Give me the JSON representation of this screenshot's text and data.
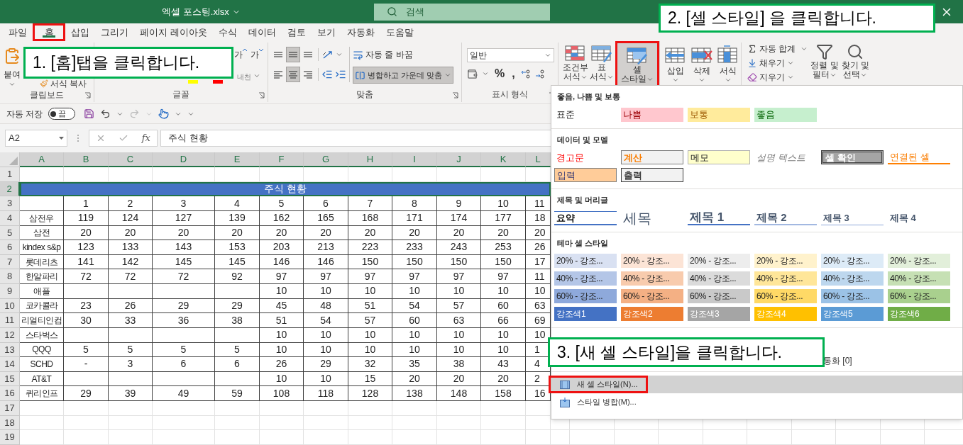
{
  "title_bar": {
    "file_name": "엑셀 포스팅.xlsx",
    "search_placeholder": "검색"
  },
  "ribbon_tabs": [
    {
      "label": "파일",
      "selected": false,
      "annotated": false
    },
    {
      "label": "홈",
      "selected": true,
      "annotated": true
    },
    {
      "label": "삽입",
      "selected": false,
      "annotated": false
    },
    {
      "label": "그리기",
      "selected": false,
      "annotated": false
    },
    {
      "label": "페이지 레이아웃",
      "selected": false,
      "annotated": false
    },
    {
      "label": "수식",
      "selected": false,
      "annotated": false
    },
    {
      "label": "데이터",
      "selected": false,
      "annotated": false
    },
    {
      "label": "검토",
      "selected": false,
      "annotated": false
    },
    {
      "label": "보기",
      "selected": false,
      "annotated": false
    },
    {
      "label": "자동화",
      "selected": false,
      "annotated": false
    },
    {
      "label": "도움말",
      "selected": false,
      "annotated": false
    }
  ],
  "ribbon": {
    "clipboard": {
      "paste_label": "붙여",
      "format_painter": "서식 복사",
      "group_label": "클립보드"
    },
    "font": {
      "grow": "가",
      "shrink": "가",
      "phonetic": "내천",
      "group_label": "글꼴"
    },
    "alignment": {
      "buttons": [
        {
          "kind": "top",
          "selected": false
        },
        {
          "kind": "middle",
          "selected": true
        },
        {
          "kind": "bottom",
          "selected": false
        },
        {
          "kind": "left",
          "selected": false
        },
        {
          "kind": "center",
          "selected": true
        },
        {
          "kind": "right",
          "selected": false
        }
      ],
      "wrap": "자동 줄 바꿈",
      "merge": {
        "label": "병합하고 가운데 맞춤",
        "selected": true
      },
      "group_label": "맞춤"
    },
    "number": {
      "format": "일반",
      "symbols": [
        "%",
        ","
      ],
      "group_label": "표시 형식"
    },
    "styles": [
      {
        "kind": "conditional",
        "lines": [
          "조건부",
          "서식"
        ],
        "selected": false,
        "annotated": false
      },
      {
        "kind": "table",
        "lines": [
          "표",
          "서식"
        ],
        "selected": false,
        "annotated": false
      },
      {
        "kind": "cell_style",
        "lines": [
          "셀",
          "스타일"
        ],
        "selected": true,
        "annotated": true
      }
    ],
    "cells": [
      {
        "kind": "insert",
        "label": "삽입"
      },
      {
        "kind": "delete",
        "label": "삭제"
      },
      {
        "kind": "format",
        "label": "서식"
      }
    ],
    "editing": {
      "autosum": "자동 합계",
      "fill": "채우기",
      "clear": "지우기",
      "sort": [
        "정렬 및",
        "필터"
      ],
      "find": [
        "찾기 및",
        "선택"
      ]
    }
  },
  "quick_access": {
    "autosave_label": "자동 저장",
    "autosave_on": false,
    "autosave_state": "끔"
  },
  "formula_bar": {
    "name_box": "A2",
    "function_label": "fx",
    "content": "주식 현황"
  },
  "sheet": {
    "columns": [
      {
        "label": "A",
        "selected": true
      },
      {
        "label": "B",
        "selected": true
      },
      {
        "label": "C",
        "selected": true
      },
      {
        "label": "D",
        "selected": true
      },
      {
        "label": "E",
        "selected": true
      },
      {
        "label": "F",
        "selected": true
      },
      {
        "label": "G",
        "selected": true
      },
      {
        "label": "H",
        "selected": true
      },
      {
        "label": "I",
        "selected": true
      },
      {
        "label": "J",
        "selected": true
      },
      {
        "label": "K",
        "selected": true
      },
      {
        "label": "L",
        "selected": true
      }
    ],
    "rows": [
      {
        "number": "1",
        "selected": false,
        "kind": "blank"
      },
      {
        "number": "2",
        "selected": true,
        "kind": "merged",
        "text": "주식 현황"
      },
      {
        "number": "3",
        "selected": false,
        "kind": "table",
        "cells": [
          null,
          "1",
          "2",
          "3",
          "4",
          "5",
          "6",
          "7",
          "8",
          "9",
          "10",
          "11"
        ]
      },
      {
        "number": "4",
        "selected": false,
        "kind": "table",
        "cells": [
          "삼전우",
          "119",
          "124",
          "127",
          "139",
          "162",
          "165",
          "168",
          "171",
          "174",
          "177",
          "18"
        ]
      },
      {
        "number": "5",
        "selected": false,
        "kind": "table",
        "cells": [
          "삼전",
          "20",
          "20",
          "20",
          "20",
          "20",
          "20",
          "20",
          "20",
          "20",
          "20",
          "20"
        ]
      },
      {
        "number": "6",
        "selected": false,
        "kind": "table",
        "cells": [
          "kindex s&p",
          "123",
          "133",
          "143",
          "153",
          "203",
          "213",
          "223",
          "233",
          "243",
          "253",
          "26"
        ]
      },
      {
        "number": "7",
        "selected": false,
        "kind": "table",
        "cells": [
          "롯데리츠",
          "141",
          "142",
          "145",
          "145",
          "146",
          "146",
          "150",
          "150",
          "150",
          "150",
          "17"
        ]
      },
      {
        "number": "8",
        "selected": false,
        "kind": "table",
        "cells": [
          "한알파리",
          "72",
          "72",
          "72",
          "92",
          "97",
          "97",
          "97",
          "97",
          "97",
          "97",
          "11"
        ]
      },
      {
        "number": "9",
        "selected": false,
        "kind": "table",
        "cells": [
          "애플",
          null,
          null,
          null,
          null,
          "10",
          "10",
          "10",
          "10",
          "10",
          "10",
          "10"
        ]
      },
      {
        "number": "10",
        "selected": false,
        "kind": "table",
        "cells": [
          "코카콜라",
          "23",
          "26",
          "29",
          "29",
          "45",
          "48",
          "51",
          "54",
          "57",
          "60",
          "63"
        ]
      },
      {
        "number": "11",
        "selected": false,
        "kind": "table",
        "cells": [
          "리얼티인컴",
          "30",
          "33",
          "36",
          "38",
          "51",
          "54",
          "57",
          "60",
          "63",
          "66",
          "69"
        ]
      },
      {
        "number": "12",
        "selected": false,
        "kind": "table",
        "cells": [
          "스타벅스",
          null,
          null,
          null,
          null,
          "10",
          "10",
          "10",
          "10",
          "10",
          "10",
          "10"
        ]
      },
      {
        "number": "13",
        "selected": false,
        "kind": "table",
        "cells": [
          "QQQ",
          "5",
          "5",
          "5",
          "5",
          "10",
          "10",
          "10",
          "10",
          "10",
          "10",
          "1"
        ]
      },
      {
        "number": "14",
        "selected": false,
        "kind": "table",
        "cells": [
          "SCHD",
          "-",
          "3",
          "6",
          "6",
          "26",
          "29",
          "32",
          "35",
          "38",
          "43",
          "4"
        ]
      },
      {
        "number": "15",
        "selected": false,
        "kind": "table",
        "cells": [
          "AT&T",
          null,
          null,
          null,
          null,
          "10",
          "10",
          "15",
          "20",
          "20",
          "20",
          "2"
        ]
      },
      {
        "number": "16",
        "selected": false,
        "kind": "table",
        "cells": [
          "퀴리인프",
          "29",
          "39",
          "49",
          "59",
          "108",
          "118",
          "128",
          "138",
          "148",
          "158",
          "16"
        ]
      },
      {
        "number": "17",
        "selected": false,
        "kind": "blank"
      },
      {
        "number": "18",
        "selected": false,
        "kind": "blank"
      },
      {
        "number": "19",
        "selected": false,
        "kind": "blank"
      }
    ]
  },
  "cell_styles_menu": {
    "sections": [
      {
        "title": "좋음, 나쁨 및 보통",
        "rows": [
          [
            {
              "kind": "normal",
              "label": "표준"
            },
            {
              "kind": "bad",
              "label": "나쁨"
            },
            {
              "kind": "neutral",
              "label": "보통"
            },
            {
              "kind": "good",
              "label": "좋음"
            }
          ]
        ]
      },
      {
        "title": "데이터 및 모델",
        "rows": [
          [
            {
              "kind": "warning",
              "label": "경고문"
            },
            {
              "kind": "calculation",
              "label": "계산"
            },
            {
              "kind": "note",
              "label": "메모"
            },
            {
              "kind": "explanatory",
              "label": "설명 텍스트"
            },
            {
              "kind": "check",
              "label": "셀 확인"
            },
            {
              "kind": "linked",
              "label": "연결된 셀"
            }
          ],
          [
            {
              "kind": "input",
              "label": "입력"
            },
            {
              "kind": "output",
              "label": "출력"
            }
          ]
        ]
      },
      {
        "title": "제목 및 머리글",
        "rows": [
          [
            {
              "kind": "total",
              "label": "요약"
            },
            {
              "kind": "title",
              "label": "세목"
            },
            {
              "kind": "heading1",
              "label": "제목 1"
            },
            {
              "kind": "heading2",
              "label": "제목 2"
            },
            {
              "kind": "heading3",
              "label": "제목 3"
            },
            {
              "kind": "heading4",
              "label": "제목 4"
            }
          ]
        ]
      },
      {
        "title": "테마 셀 스타일",
        "rows": [
          [
            {
              "kind": "tint",
              "label": "20% - 강조...",
              "color": "#d9e1f2"
            },
            {
              "kind": "tint",
              "label": "20% - 강조...",
              "color": "#fce4d6"
            },
            {
              "kind": "tint",
              "label": "20% - 강조...",
              "color": "#ededed"
            },
            {
              "kind": "tint",
              "label": "20% - 강조...",
              "color": "#fff2cc"
            },
            {
              "kind": "tint",
              "label": "20% - 강조...",
              "color": "#ddebf7"
            },
            {
              "kind": "tint",
              "label": "20% - 강조...",
              "color": "#e2efda"
            }
          ],
          [
            {
              "kind": "tint",
              "label": "40% - 강조...",
              "color": "#b4c6e7"
            },
            {
              "kind": "tint",
              "label": "40% - 강조...",
              "color": "#f8cbad"
            },
            {
              "kind": "tint",
              "label": "40% - 강조...",
              "color": "#dbdbdb"
            },
            {
              "kind": "tint",
              "label": "40% - 강조...",
              "color": "#ffe699"
            },
            {
              "kind": "tint",
              "label": "40% - 강조...",
              "color": "#bdd7ee"
            },
            {
              "kind": "tint",
              "label": "40% - 강조...",
              "color": "#c6e0b4"
            }
          ],
          [
            {
              "kind": "tint",
              "label": "60% - 강조...",
              "color": "#8ea9db"
            },
            {
              "kind": "tint",
              "label": "60% - 강조...",
              "color": "#f4b084"
            },
            {
              "kind": "tint",
              "label": "60% - 강조...",
              "color": "#c9c9c9"
            },
            {
              "kind": "tint",
              "label": "60% - 강조...",
              "color": "#ffd966"
            },
            {
              "kind": "tint",
              "label": "60% - 강조...",
              "color": "#9bc2e6"
            },
            {
              "kind": "tint",
              "label": "60% - 강조...",
              "color": "#a9d08e"
            }
          ],
          [
            {
              "kind": "accent",
              "label": "강조색1",
              "color": "#4472c4"
            },
            {
              "kind": "accent",
              "label": "강조색2",
              "color": "#ed7d31"
            },
            {
              "kind": "accent",
              "label": "강조색3",
              "color": "#a5a5a5"
            },
            {
              "kind": "accent",
              "label": "강조색4",
              "color": "#ffc000"
            },
            {
              "kind": "accent",
              "label": "강조색5",
              "color": "#5b9bd5"
            },
            {
              "kind": "accent",
              "label": "강조색6",
              "color": "#70ad47"
            }
          ]
        ]
      }
    ],
    "partial_item": "통화 [0]",
    "items": [
      {
        "kind": "new",
        "label": "새 셀 스타일(N)...",
        "selected": true,
        "annotated": true
      },
      {
        "kind": "merge",
        "label": "스타일 병합(M)...",
        "selected": false,
        "annotated": false
      }
    ]
  },
  "callouts": [
    {
      "text": "1. [홈]탭을 클릭합니다."
    },
    {
      "text": "2. [셀 스타일] 을 클릭합니다."
    },
    {
      "text": "3. [새 셀 스타일]을 클릭합니다."
    }
  ]
}
